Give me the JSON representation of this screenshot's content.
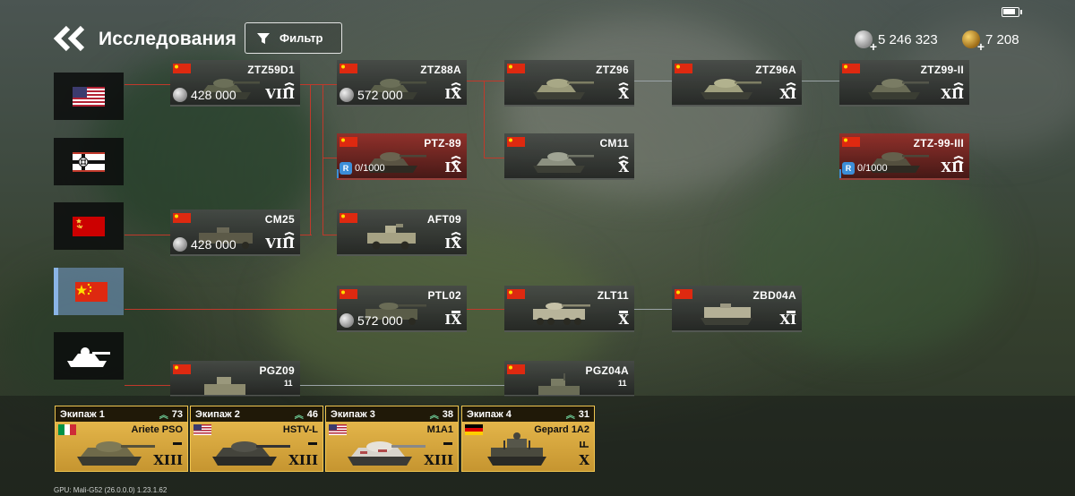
{
  "header": {
    "title": "Исследования",
    "filter_label": "Фильтр",
    "silver": "5 246 323",
    "gold": "7 208",
    "battery_level": 0.8
  },
  "nations": [
    {
      "id": "usa",
      "selected": false
    },
    {
      "id": "germany",
      "selected": false
    },
    {
      "id": "ussr",
      "selected": false
    },
    {
      "id": "china",
      "selected": true
    },
    {
      "id": "armored",
      "selected": false
    }
  ],
  "vehicles": {
    "ztz59d1": {
      "name": "ZTZ59D1",
      "tier": "VIII",
      "price": "428 000",
      "rank": "2"
    },
    "ztz88a": {
      "name": "ZTZ88A",
      "tier": "IX",
      "price": "572 000",
      "rank": "2"
    },
    "ztz96": {
      "name": "ZTZ96",
      "tier": "X",
      "rank": "1"
    },
    "ztz96a": {
      "name": "ZTZ96A",
      "tier": "XI",
      "rank": "1"
    },
    "ztz99ii": {
      "name": "ZTZ99-II",
      "tier": "XII",
      "rank": "1"
    },
    "ptz89": {
      "name": "PTZ-89",
      "tier": "IX",
      "rp": "0/1000",
      "rank": "2"
    },
    "cm11": {
      "name": "CM11",
      "tier": "X",
      "rank": "1"
    },
    "ztz99iii": {
      "name": "ZTZ-99-III",
      "tier": "XII",
      "rp": "0/1000",
      "rank": "1"
    },
    "cm25": {
      "name": "CM25",
      "tier": "VIII",
      "price": "428 000",
      "rank": "2"
    },
    "aft09": {
      "name": "AFT09",
      "tier": "IX",
      "rank": "2"
    },
    "ptl02": {
      "name": "PTL02",
      "tier": "IX",
      "price": "572 000",
      "rank": "—"
    },
    "zlt11": {
      "name": "ZLT11",
      "tier": "X",
      "rank": "—"
    },
    "zbd04a": {
      "name": "ZBD04A",
      "tier": "XI",
      "rank": "—"
    },
    "pgz09": {
      "name": "PGZ09",
      "tier": "",
      "rank": "11"
    },
    "pgz04a": {
      "name": "PGZ04A",
      "tier": "",
      "rank": "11"
    }
  },
  "crews": [
    {
      "label": "Экипаж 1",
      "level": "73",
      "tank": "Ariete PSO",
      "tier": "XIII",
      "flag": "italy"
    },
    {
      "label": "Экипаж 2",
      "level": "46",
      "tank": "HSTV-L",
      "tier": "XIII",
      "flag": "usa"
    },
    {
      "label": "Экипаж 3",
      "level": "38",
      "tank": "M1A1",
      "tier": "XIII",
      "flag": "usa"
    },
    {
      "label": "Экипаж 4",
      "level": "31",
      "tank": "Gepard 1A2",
      "tier": "X",
      "flag": "germany"
    }
  ],
  "footer": {
    "gpu": "GPU: Mali-G52 (26.0.0.0)   1.23.1.62"
  },
  "colors": {
    "tree_line": "#c0392b",
    "accent_blue": "#3c8ed8",
    "crew_gold": "#d6a839"
  }
}
